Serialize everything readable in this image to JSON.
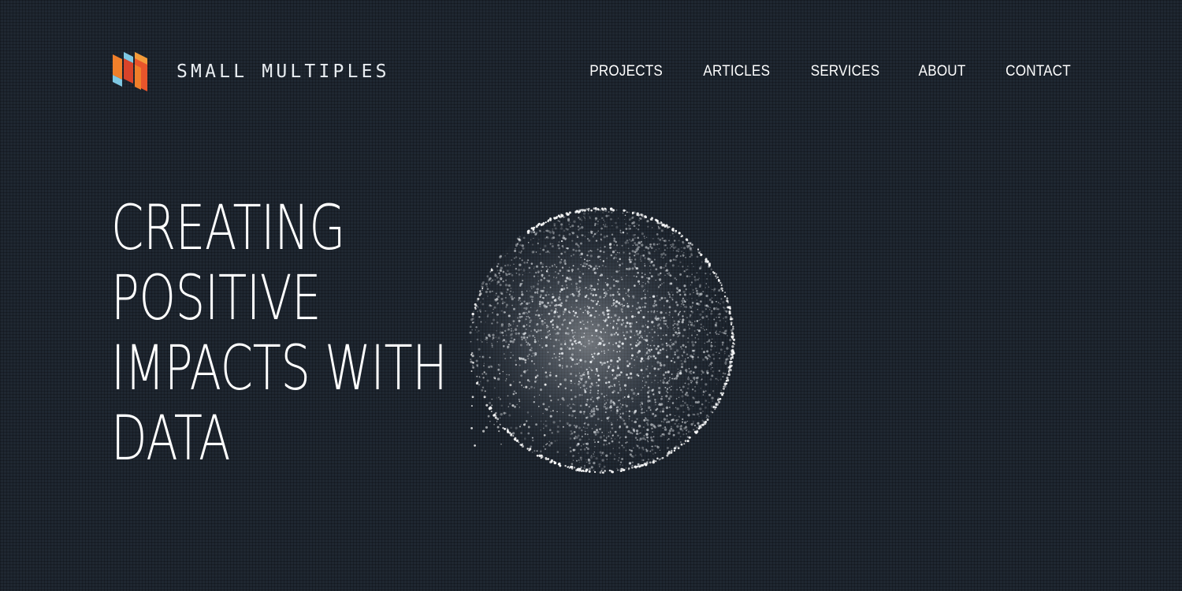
{
  "header": {
    "brand_name": "SMALL MULTIPLES",
    "logo_icon": "small-multiples-logo-icon",
    "nav": [
      {
        "label": "PROJECTS"
      },
      {
        "label": "ARTICLES"
      },
      {
        "label": "SERVICES"
      },
      {
        "label": "ABOUT"
      },
      {
        "label": "CONTACT"
      }
    ]
  },
  "hero": {
    "title_lines": [
      "CREATING",
      "POSITIVE",
      "IMPACTS WITH",
      "DATA"
    ],
    "graphic_icon": "particle-globe-icon"
  },
  "colors": {
    "background": "#1f2731",
    "text": "#ffffff",
    "logo_orange": "#f07f2a",
    "logo_red": "#d9432a",
    "logo_blue": "#7ec8e3"
  }
}
